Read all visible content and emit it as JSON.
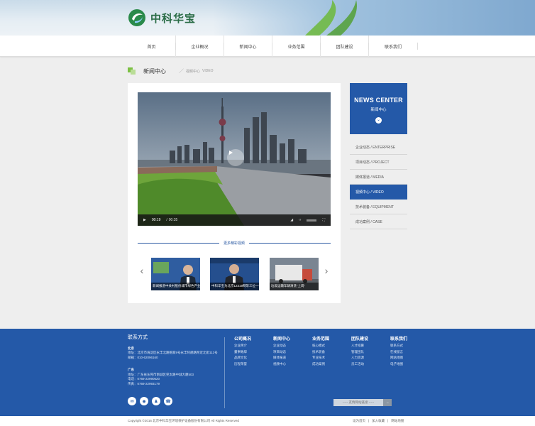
{
  "brand": {
    "name": "中科华宝",
    "green": "#2a6c46",
    "blue": "#2459a8"
  },
  "nav": {
    "items": [
      "首页",
      "企业概况",
      "新闻中心",
      "业务范围",
      "团队建设",
      "联系我们"
    ]
  },
  "page": {
    "title": "新闻中心",
    "breadcrumb_cn": "视频中心",
    "breadcrumb_en": "VIDEO"
  },
  "video": {
    "time_current": "00:19",
    "time_total": "00:35"
  },
  "more": {
    "label": "更多精彩视频"
  },
  "thumbs": [
    {
      "caption": "新闻报道中关村股份城市绿色产业"
    },
    {
      "caption": "中科华宝为北京12319网等三位一体化“保驾”"
    },
    {
      "caption": "垃圾运输车辆清洗“上岗”"
    }
  ],
  "side": {
    "title_en": "NEWS CENTER",
    "title_cn": "新闻中心",
    "items": [
      "企业动态 / ENTERPRISE",
      "项目动态 / PROJECT",
      "媒体报道 / MEDIA",
      "视频中心 / VIDEO",
      "技术装备 / EQUIPMENT",
      "成功案例 / CASE"
    ]
  },
  "footer": {
    "contact_title": "联系方式",
    "beijing": {
      "city": "北京",
      "addr": "地址：北京市海淀区永丰北路鲍家9号永丰阿赫路附近北街112号",
      "email": "邮箱：010-62096160"
    },
    "guangdong": {
      "city": "广东",
      "addr": "地址：广东省东莞市南城区莞太路中城大厦503",
      "tel": "电话：0769-22990620",
      "fax": "传真：0769-22993179"
    },
    "cols": [
      {
        "title": "公司概况",
        "items": [
          "企业简介",
          "董事致辞",
          "品牌文化",
          "历程荣誉"
        ]
      },
      {
        "title": "新闻中心",
        "items": [
          "企业动态",
          "项目动态",
          "媒体报道",
          "视频中心"
        ]
      },
      {
        "title": "业务范围",
        "items": [
          "核心模式",
          "技术装备",
          "专业技术",
          "成功案例"
        ]
      },
      {
        "title": "团队建设",
        "items": [
          "人才招募",
          "管理团队",
          "人力资源",
          "员工活动"
        ]
      },
      {
        "title": "联系我们",
        "items": [
          "联系方式",
          "在线留言",
          "网站地图",
          "电子地图"
        ]
      }
    ],
    "links_placeholder": "----- 友情网站链接 -----",
    "go": "→"
  },
  "bottom": {
    "copyright": "Copyright ©2016 北京中科华宝环境保护设备股份有限公司  All Rights Reserved",
    "links": [
      "设为首页",
      "|",
      "加入收藏",
      "|",
      "网站地图"
    ]
  }
}
